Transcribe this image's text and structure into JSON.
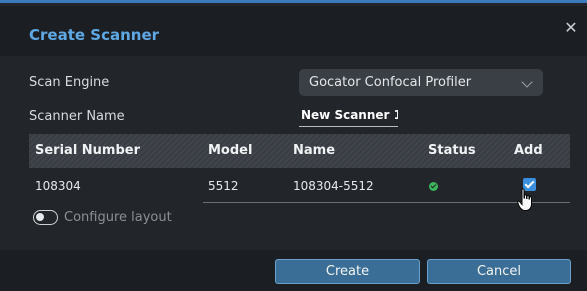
{
  "dialog": {
    "title": "Create Scanner",
    "close_symbol": "✕"
  },
  "form": {
    "scan_engine_label": "Scan Engine",
    "scan_engine_value": "Gocator Confocal Profiler",
    "scanner_name_label": "Scanner Name",
    "scanner_name_value": "New Scanner 1"
  },
  "table": {
    "headers": [
      "Serial Number",
      "Model",
      "Name",
      "Status",
      "Add"
    ],
    "rows": [
      {
        "serial": "108304",
        "model": "5512",
        "name": "108304-5512",
        "status": "ok",
        "add_checked": true
      }
    ]
  },
  "configure_layout": {
    "label": "Configure layout",
    "enabled": false
  },
  "buttons": {
    "create": "Create",
    "cancel": "Cancel"
  },
  "colors": {
    "title": "#5ea9e4",
    "accent": "#3a7ab8",
    "button": "#3b6e96",
    "status_ok": "#3cb45a",
    "checkbox": "#3a8fde"
  },
  "icons": {
    "close": "close-icon",
    "dropdown": "chevron-down-icon",
    "status": "status-ok-icon",
    "pointer": "hand-pointer-cursor-icon"
  }
}
